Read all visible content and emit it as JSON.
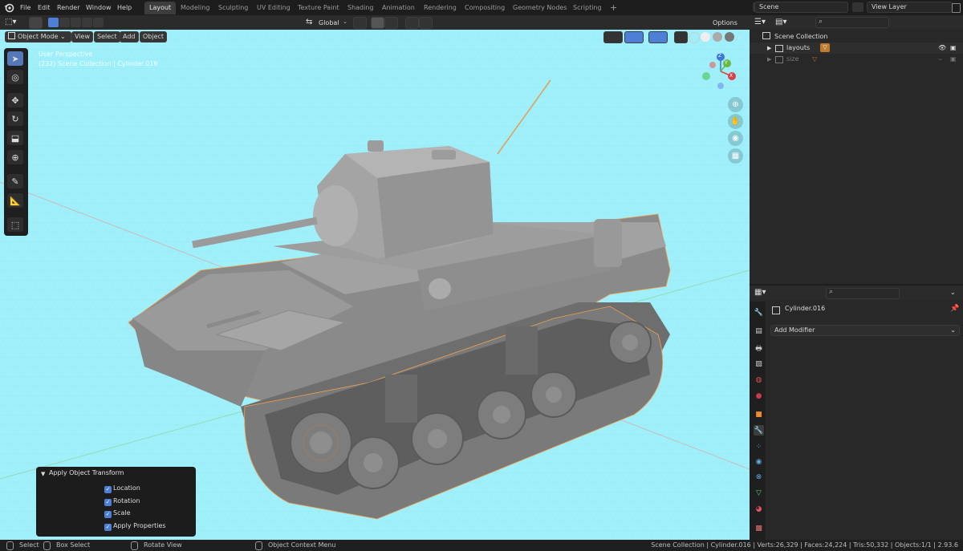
{
  "menu": [
    "File",
    "Edit",
    "Render",
    "Window",
    "Help"
  ],
  "workspaces": [
    "Layout",
    "Modeling",
    "Sculpting",
    "UV Editing",
    "Texture Paint",
    "Shading",
    "Animation",
    "Rendering",
    "Compositing",
    "Geometry Nodes",
    "Scripting",
    "+"
  ],
  "scene": {
    "name": "Scene",
    "view_layer": "View Layer"
  },
  "header": {
    "orientation": "Global",
    "options": "Options"
  },
  "viewport_header": {
    "mode": "Object Mode",
    "menus": [
      "View",
      "Select",
      "Add",
      "Object"
    ]
  },
  "viewport_overlay": {
    "line1": "User Perspective",
    "line2": "(232) Scene Collection | Cylinder.016"
  },
  "gizmo": {
    "x": "X",
    "y": "Y",
    "z": "Z"
  },
  "outliner": {
    "root": "Scene Collection",
    "items": [
      {
        "label": "layouts"
      },
      {
        "label": "size"
      }
    ]
  },
  "properties": {
    "object_name": "Cylinder.016",
    "add_modifier": "Add Modifier"
  },
  "operator_panel": {
    "title": "Apply Object Transform",
    "options": [
      {
        "label": "Location",
        "checked": true
      },
      {
        "label": "Rotation",
        "checked": true
      },
      {
        "label": "Scale",
        "checked": true
      },
      {
        "label": "Apply Properties",
        "checked": true
      }
    ]
  },
  "statusbar": {
    "select": "Select",
    "box_select": "Box Select",
    "rotate_view": "Rotate View",
    "context_menu": "Object Context Menu",
    "stats": "Scene Collection | Cylinder.016 | Verts:26,329 | Faces:24,224 | Tris:50,332 | Objects:1/1 | 2.93.6"
  },
  "colors": {
    "viewport_bg": "#9ff0fb",
    "accent": "#4d7fd7",
    "active_tab": "#3d3d3d"
  }
}
